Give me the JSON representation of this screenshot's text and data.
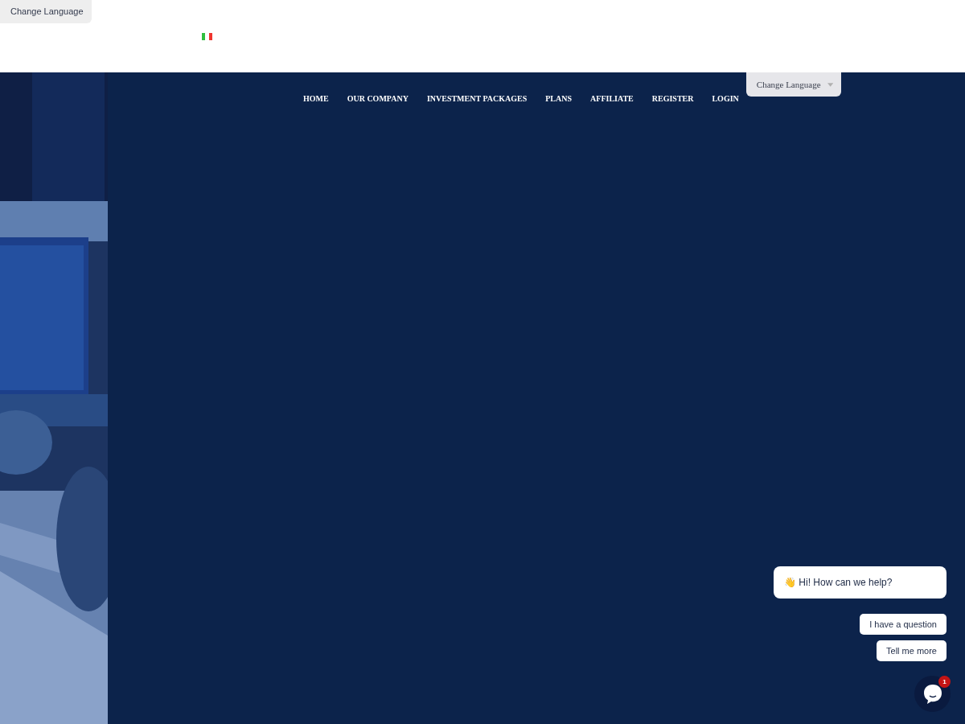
{
  "top_bar": {
    "language_select": {
      "label": "Change Language"
    }
  },
  "nav": {
    "items": [
      "HOME",
      "OUR COMPANY",
      "INVESTMENT PACKAGES",
      "PLANS",
      "AFFILIATE",
      "REGISTER",
      "LOGIN"
    ],
    "language_select": {
      "label": "Change Language"
    }
  },
  "chat": {
    "greeting": "Hi! How can we help?",
    "wave": "👋",
    "quick_replies": [
      "I have a question",
      "Tell me more"
    ],
    "badge": "1"
  }
}
